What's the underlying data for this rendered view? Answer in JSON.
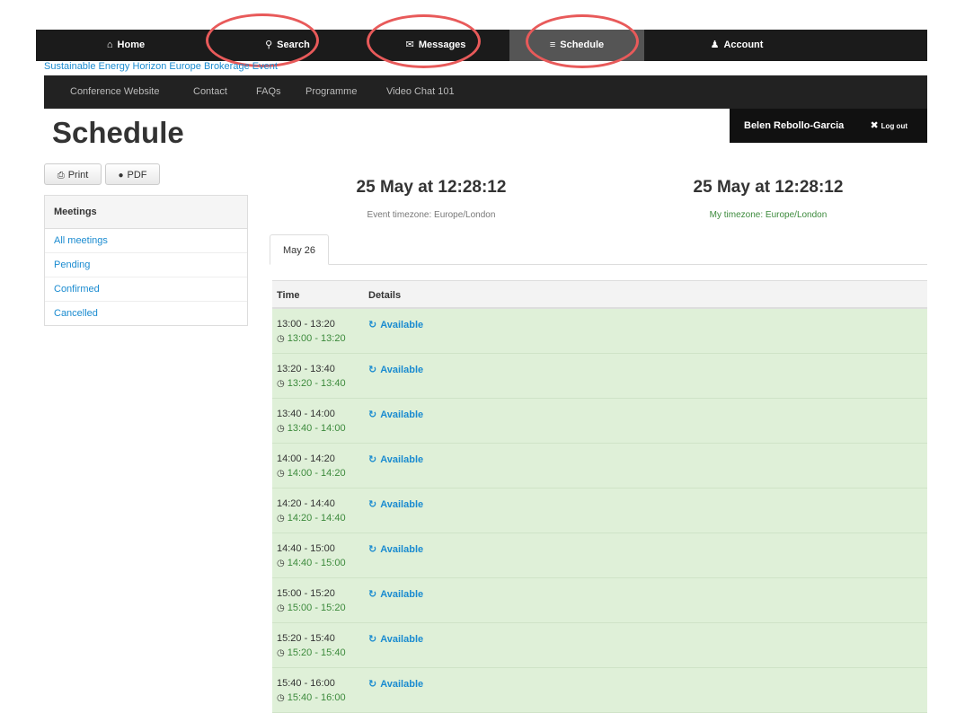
{
  "topnav": [
    {
      "icon": "home-icon",
      "glyph": "⌂",
      "label": "Home"
    },
    {
      "icon": "search-icon",
      "glyph": "⚲",
      "label": "Search"
    },
    {
      "icon": "envelope-icon",
      "glyph": "✉",
      "label": "Messages"
    },
    {
      "icon": "list-icon",
      "glyph": "≡",
      "label": "Schedule"
    },
    {
      "icon": "user-icon",
      "glyph": "♟",
      "label": "Account"
    }
  ],
  "event_title": "Sustainable Energy Horizon Europe Brokerage Event",
  "subnav": [
    "Conference Website",
    "Contact",
    "FAQs",
    "Programme",
    "Video Chat 101"
  ],
  "page_title": "Schedule",
  "user": {
    "name": "Belen Rebollo-Garcia",
    "logout": "Log out",
    "logout_glyph": "✖"
  },
  "buttons": {
    "print": "Print",
    "print_glyph": "⎙",
    "pdf": "PDF",
    "pdf_glyph": "●"
  },
  "sidebar": {
    "heading": "Meetings",
    "items": [
      "All meetings",
      "Pending",
      "Confirmed",
      "Cancelled"
    ]
  },
  "clocks": {
    "event_time": "25 May at 12:28:12",
    "event_tz": "Event timezone: Europe/London",
    "my_time": "25 May at 12:28:12",
    "my_tz": "My timezone: Europe/London"
  },
  "tab": "May 26",
  "table": {
    "headers": {
      "time": "Time",
      "details": "Details"
    },
    "status_glyph": "↻",
    "clock_glyph": "◷",
    "rows": [
      {
        "time": "13:00 - 13:20",
        "local": "13:00 - 13:20",
        "status": "Available"
      },
      {
        "time": "13:20 - 13:40",
        "local": "13:20 - 13:40",
        "status": "Available"
      },
      {
        "time": "13:40 - 14:00",
        "local": "13:40 - 14:00",
        "status": "Available"
      },
      {
        "time": "14:00 - 14:20",
        "local": "14:00 - 14:20",
        "status": "Available"
      },
      {
        "time": "14:20 - 14:40",
        "local": "14:20 - 14:40",
        "status": "Available"
      },
      {
        "time": "14:40 - 15:00",
        "local": "14:40 - 15:00",
        "status": "Available"
      },
      {
        "time": "15:00 - 15:20",
        "local": "15:00 - 15:20",
        "status": "Available"
      },
      {
        "time": "15:20 - 15:40",
        "local": "15:20 - 15:40",
        "status": "Available"
      },
      {
        "time": "15:40 - 16:00",
        "local": "15:40 - 16:00",
        "status": "Available"
      }
    ]
  },
  "colors": {
    "accent": "#1a8bd0",
    "available_bg": "#dff0d8",
    "highlight_circle": "#e85a5a",
    "nav_bg": "#1b1b1b"
  }
}
